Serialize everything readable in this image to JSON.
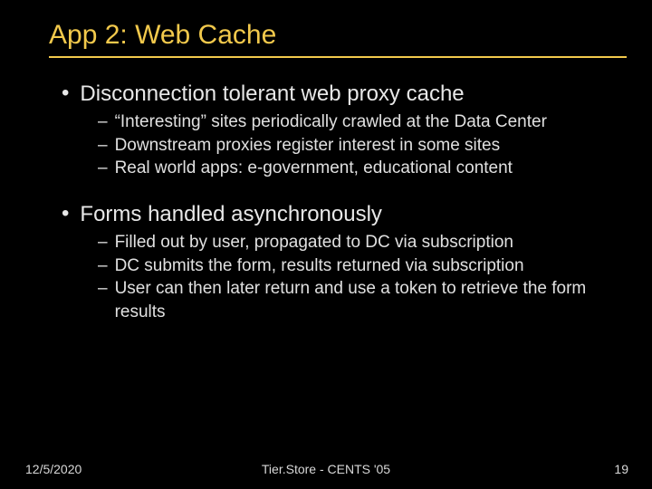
{
  "title": "App 2: Web Cache",
  "bullets": [
    {
      "text": "Disconnection tolerant web proxy cache",
      "sub": [
        "“Interesting” sites periodically crawled at the Data Center",
        "Downstream proxies register interest in some sites",
        "Real world apps: e-government, educational content"
      ]
    },
    {
      "text": "Forms handled asynchronously",
      "sub": [
        "Filled out by user, propagated to DC via subscription",
        "DC submits the form, results returned via subscription",
        "User can then later return and use a token to retrieve the form results"
      ]
    }
  ],
  "footer": {
    "date": "12/5/2020",
    "center": "Tier.Store - CENTS '05",
    "page": "19"
  }
}
